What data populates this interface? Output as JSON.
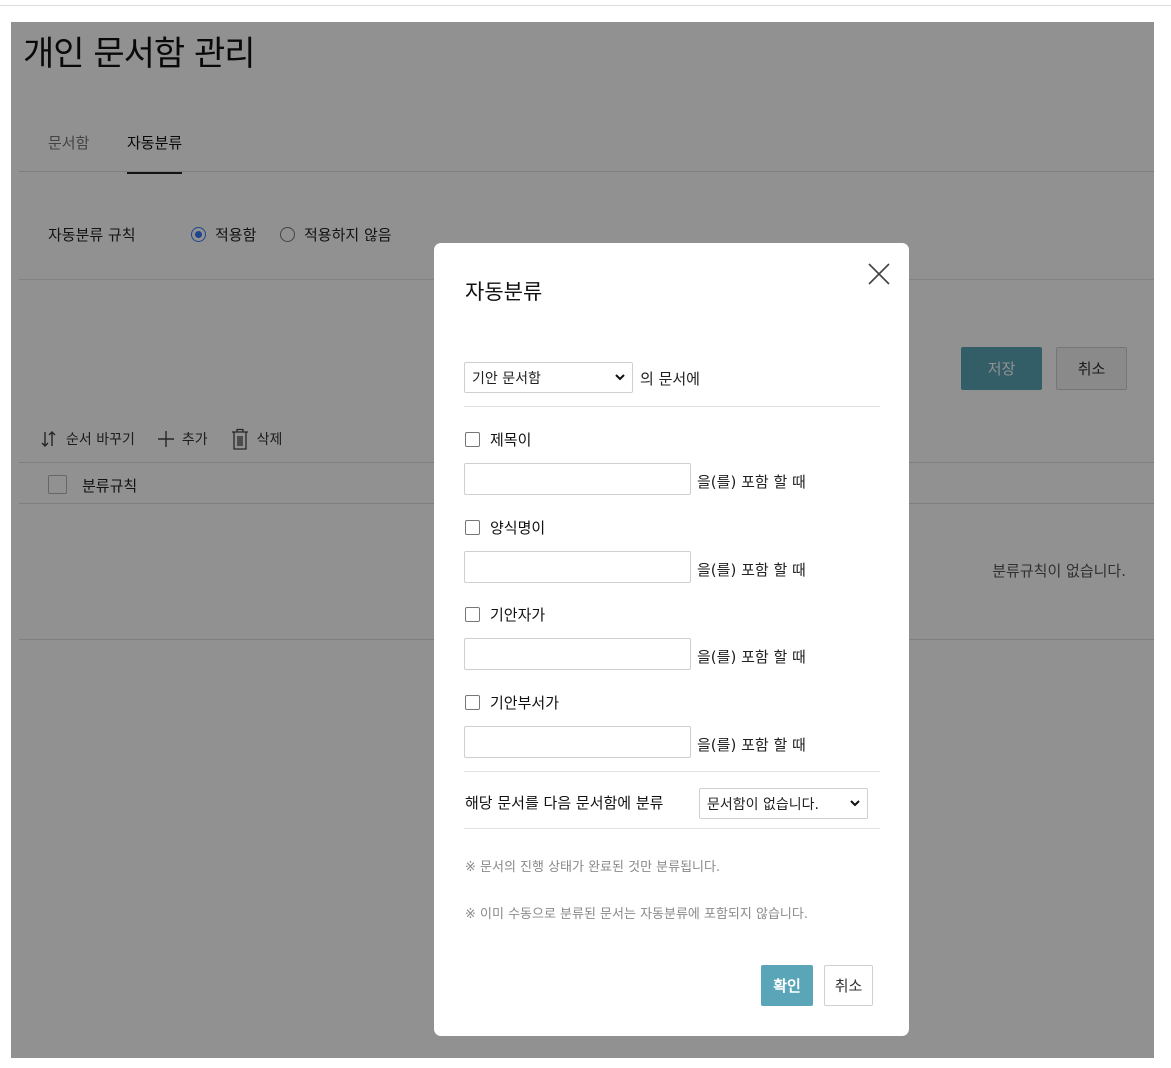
{
  "page": {
    "title": "개인 문서함 관리",
    "tabs": [
      {
        "label": "문서함",
        "active": false
      },
      {
        "label": "자동분류",
        "active": true
      }
    ],
    "rule": {
      "label": "자동분류 규칙",
      "options": [
        {
          "label": "적용함",
          "selected": true
        },
        {
          "label": "적용하지 않음",
          "selected": false
        }
      ]
    },
    "buttons": {
      "save": "저장",
      "cancel": "취소"
    },
    "toolbar": {
      "reorder": "순서 바꾸기",
      "add": "추가",
      "delete": "삭제"
    },
    "list": {
      "header": "분류규칙",
      "empty": "분류규칙이 없습니다."
    }
  },
  "modal": {
    "title": "자동분류",
    "source_select": {
      "value": "기안 문서함"
    },
    "source_suffix": "의 문서에",
    "conditions": [
      {
        "label": "제목이",
        "value": "",
        "suffix": "을(를) 포함 할 때",
        "checked": false
      },
      {
        "label": "양식명이",
        "value": "",
        "suffix": "을(를) 포함 할 때",
        "checked": false
      },
      {
        "label": "기안자가",
        "value": "",
        "suffix": "을(를) 포함 할 때",
        "checked": false
      },
      {
        "label": "기안부서가",
        "value": "",
        "suffix": "을(를) 포함 할 때",
        "checked": false
      }
    ],
    "assign_label": "해당 문서를 다음 문서함에 분류",
    "assign_select": {
      "value": "문서함이 없습니다."
    },
    "notes": [
      "※ 문서의 진행 상태가 완료된 것만 분류됩니다.",
      "※ 이미 수동으로 분류된 문서는 자동분류에 포함되지 않습니다."
    ],
    "confirm": "확인",
    "cancel": "취소"
  },
  "colors": {
    "accent": "#5aa5b8",
    "radio_selected": "#3478f6",
    "overlay": "rgba(0,0,0,0.43)"
  },
  "icons": [
    "reorder-icon",
    "plus-icon",
    "trash-icon",
    "close-icon",
    "chevron-down-icon"
  ]
}
